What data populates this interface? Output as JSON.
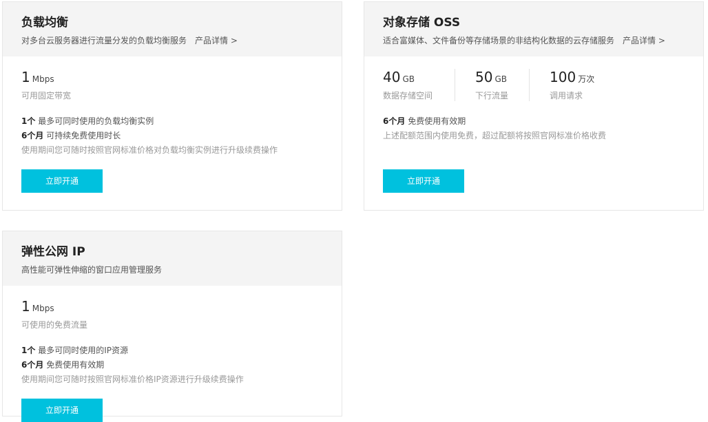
{
  "cards": [
    {
      "title": "负载均衡",
      "desc": "对多台云服务器进行流量分发的负载均衡服务",
      "detail_link": "产品详情 >",
      "metric": {
        "value": "1",
        "unit": "Mbps",
        "label": "可用固定带宽"
      },
      "lines": [
        {
          "bold": "1个",
          "text": "最多可同时使用的负载均衡实例"
        },
        {
          "bold": "6个月",
          "text": "可持续免费使用时长"
        }
      ],
      "note": "使用期间您可随时按照官网标准价格对负载均衡实例进行升级续费操作",
      "button": "立即开通"
    },
    {
      "title": "对象存储 OSS",
      "desc": "适合富媒体、文件备份等存储场景的非结构化数据的云存储服务",
      "detail_link": "产品详情 >",
      "metrics": [
        {
          "value": "40",
          "unit": "GB",
          "label": "数据存储空间"
        },
        {
          "value": "50",
          "unit": "GB",
          "label": "下行流量"
        },
        {
          "value": "100",
          "unit": "万次",
          "label": "调用请求"
        }
      ],
      "lines": [
        {
          "bold": "6个月",
          "text": "免费使用有效期"
        }
      ],
      "note": "上述配额范围内使用免费，超过配额将按照官网标准价格收费",
      "button": "立即开通"
    },
    {
      "title": "弹性公网 IP",
      "desc": "高性能可弹性伸缩的窗口应用管理服务",
      "metric": {
        "value": "1",
        "unit": "Mbps",
        "label": "可使用的免费流量"
      },
      "lines": [
        {
          "bold": "1个",
          "text": "最多可同时使用的IP资源"
        },
        {
          "bold": "6个月",
          "text": "免费使用有效期"
        }
      ],
      "note": "使用期间您可随时按照官网标准价格IP资源进行升级续费操作",
      "button": "立即开通"
    }
  ],
  "colors": {
    "accent": "#00c1de",
    "header_bg": "#f4f4f4"
  }
}
